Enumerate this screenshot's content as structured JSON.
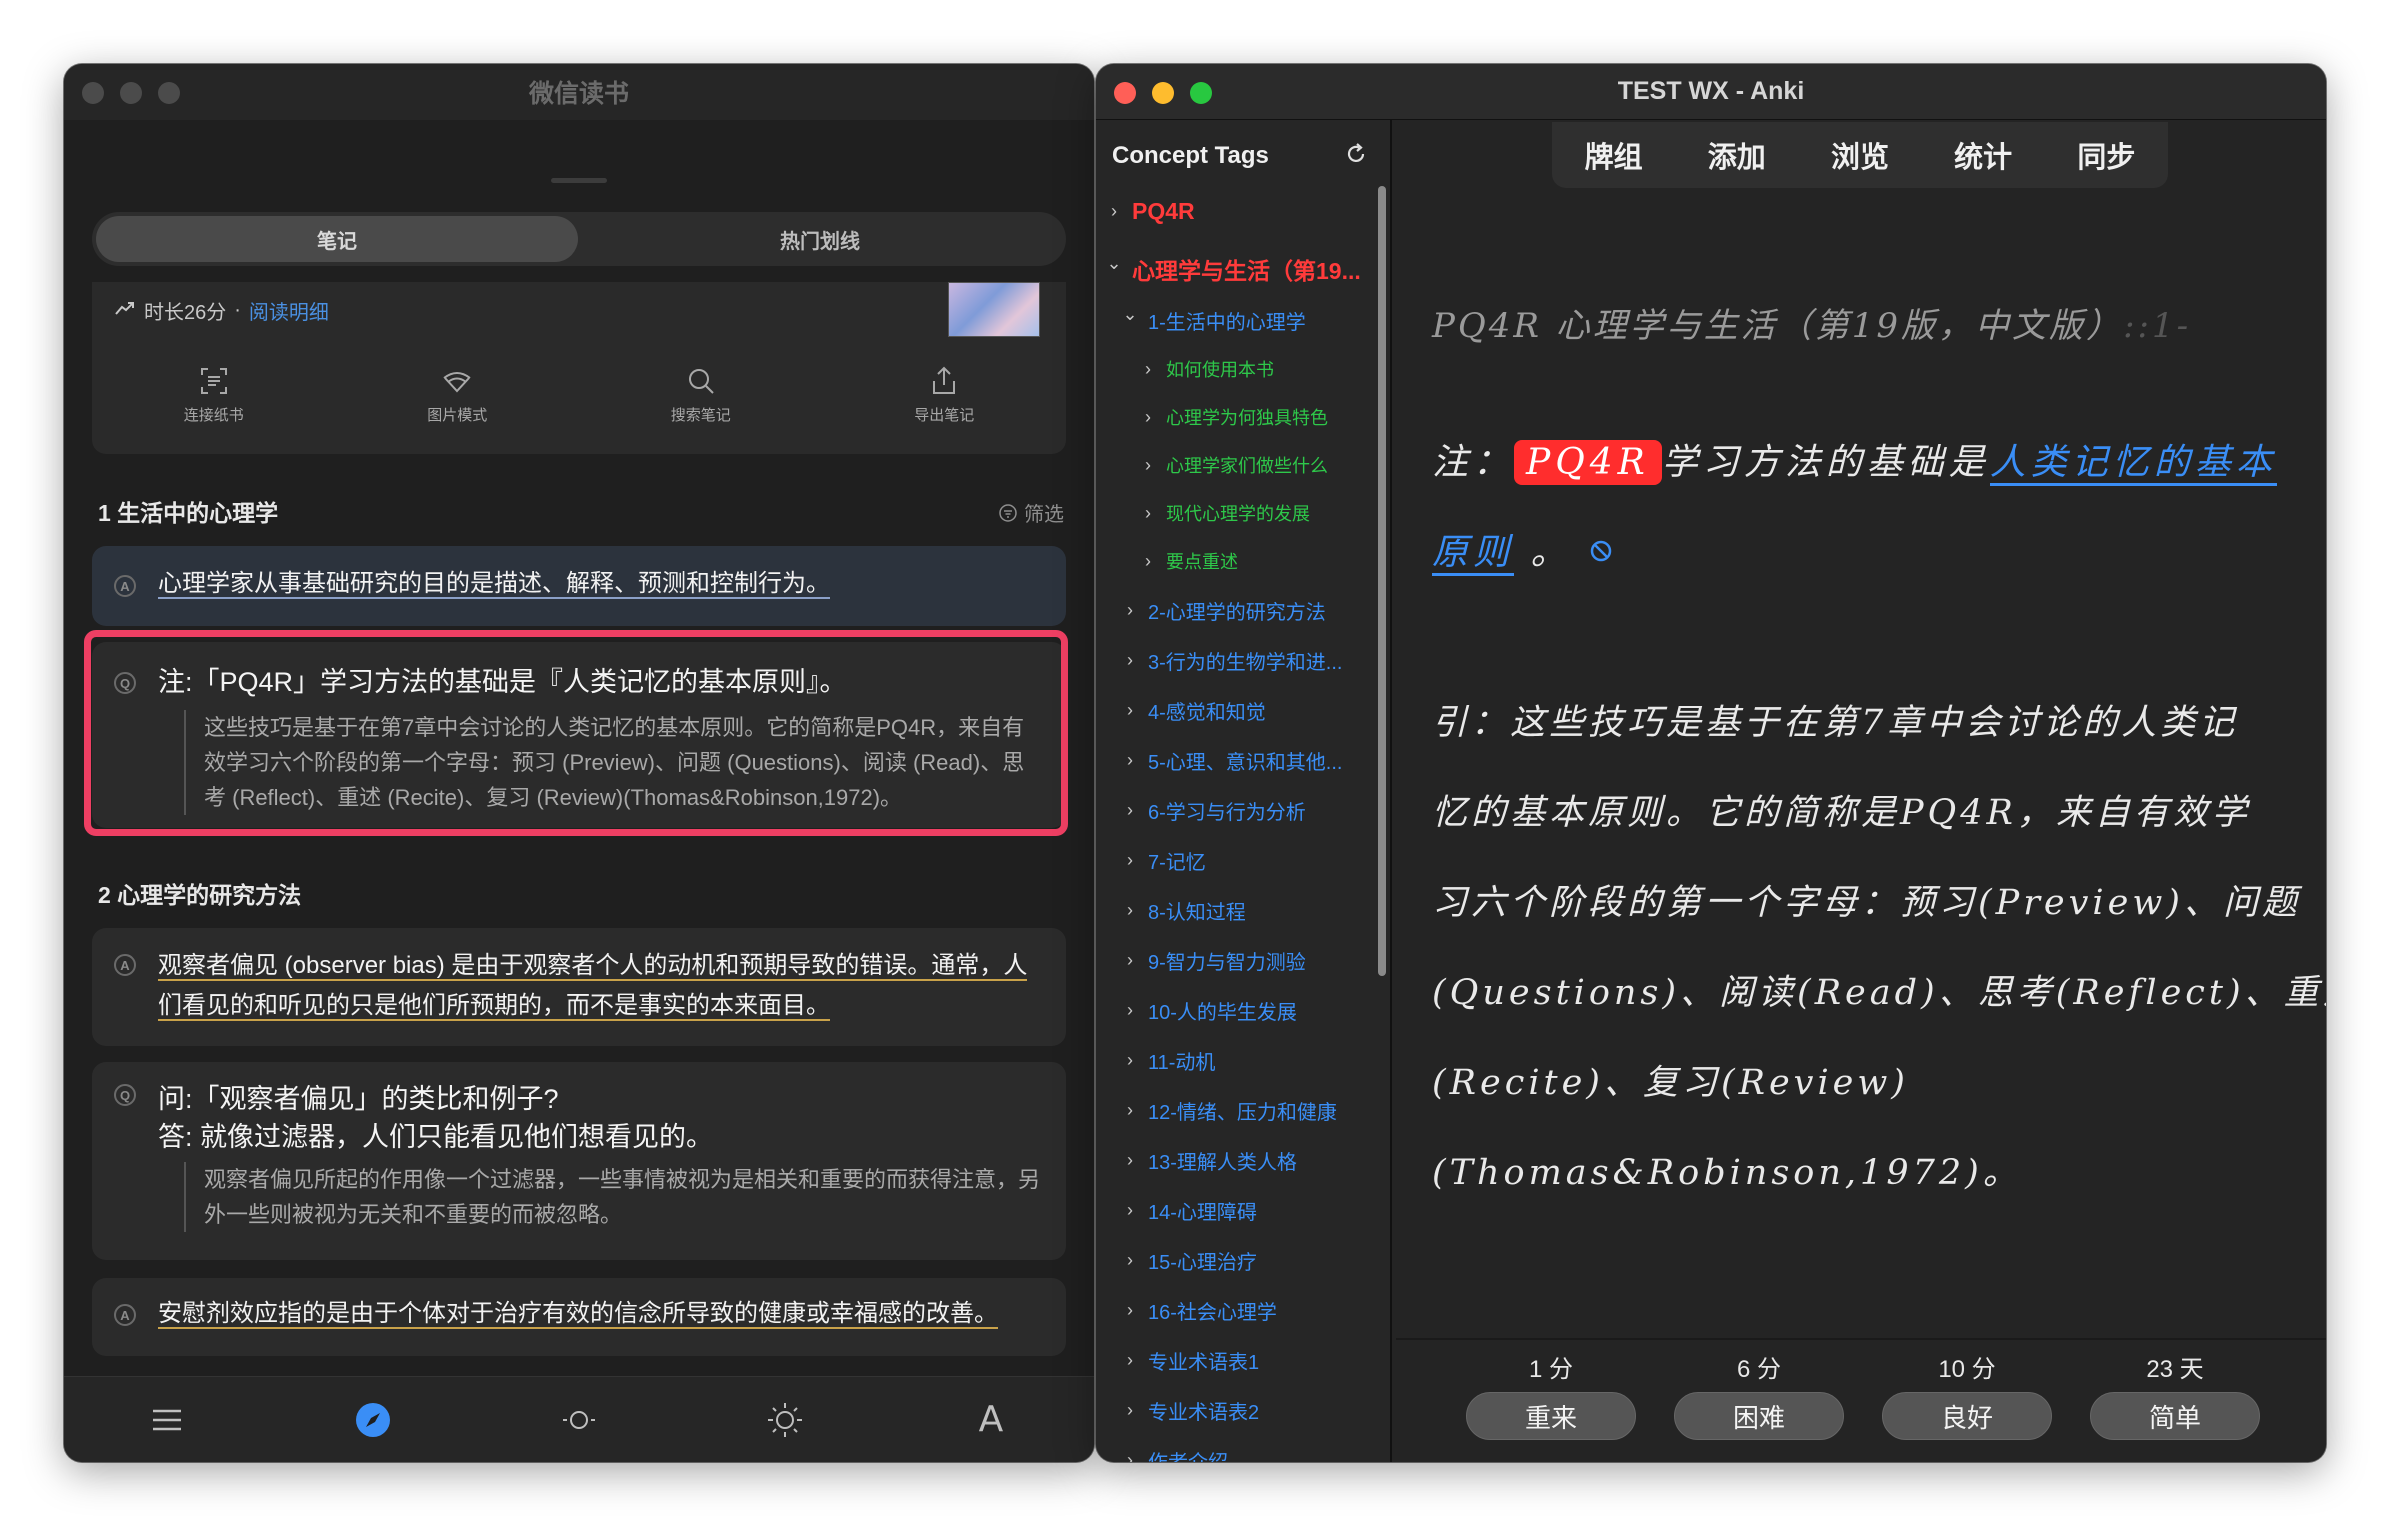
{
  "wechat": {
    "title": "微信读书",
    "tabs": {
      "notes": "笔记",
      "hot": "热门划线"
    },
    "reading": {
      "duration": "时长26分",
      "separator": "·",
      "detail_link": "阅读明细"
    },
    "tools": [
      {
        "label": "连接纸书",
        "icon": "scan-icon"
      },
      {
        "label": "图片模式",
        "icon": "image-mode-icon"
      },
      {
        "label": "搜索笔记",
        "icon": "search-icon"
      },
      {
        "label": "导出笔记",
        "icon": "export-icon"
      }
    ],
    "filter": "筛选",
    "section1": "1 生活中的心理学",
    "note1": "心理学家从事基础研究的目的是描述、解释、预测和控制行为。",
    "note2": {
      "title": "注:「PQ4R」学习方法的基础是『人类记忆的基本原则』。",
      "quote": "这些技巧是基于在第7章中会讨论的人类记忆的基本原则。它的简称是PQ4R，来自有效学习六个阶段的第一个字母：预习 (Preview)、问题 (Questions)、阅读 (Read)、思考 (Reflect)、重述 (Recite)、复习 (Review)(Thomas&Robinson,1972)。"
    },
    "section2": "2 心理学的研究方法",
    "note3": "观察者偏见 (observer bias) 是由于观察者个人的动机和预期导致的错误。通常，人们看见的和听见的只是他们所预期的，而不是事实的本来面目。",
    "note4": {
      "q": "问:「观察者偏见」的类比和例子?",
      "a": "答:  就像过滤器，人们只能看见他们想看见的。",
      "quote": "观察者偏见所起的作用像一个过滤器，一些事情被视为是相关和重要的而获得注意，另外一些则被视为无关和不重要的而被忽略。"
    },
    "note5": "安慰剂效应指的是由于个体对于治疗有效的信念所导致的健康或幸福感的改善。",
    "badges": {
      "a": "A",
      "q": "Q"
    },
    "bottom_icons": [
      "menu-icon",
      "compass-icon",
      "brightness-low-icon",
      "brightness-high-icon",
      "font-icon"
    ],
    "font_glyph": "A"
  },
  "anki": {
    "title": "TEST WX - Anki",
    "sidebar_title": "Concept Tags",
    "tree": [
      {
        "label": "PQ4R",
        "level": 0,
        "open": false,
        "color": "#ff3b3b"
      },
      {
        "label": "心理学与生活（第19...",
        "level": 0,
        "open": true,
        "color": "#ff3b3b"
      },
      {
        "label": "1-生活中的心理学",
        "level": 1,
        "open": true,
        "color": "#3a8ef6"
      },
      {
        "label": "如何使用本书",
        "level": 2,
        "open": false,
        "color": "#2ec84a"
      },
      {
        "label": "心理学为何独具特色",
        "level": 2,
        "open": false,
        "color": "#2ec84a"
      },
      {
        "label": "心理学家们做些什么",
        "level": 2,
        "open": false,
        "color": "#2ec84a"
      },
      {
        "label": "现代心理学的发展",
        "level": 2,
        "open": false,
        "color": "#2ec84a"
      },
      {
        "label": "要点重述",
        "level": 2,
        "open": false,
        "color": "#2ec84a"
      },
      {
        "label": "2-心理学的研究方法",
        "level": 1,
        "open": false,
        "color": "#3a8ef6"
      },
      {
        "label": "3-行为的生物学和进...",
        "level": 1,
        "open": false,
        "color": "#3a8ef6"
      },
      {
        "label": "4-感觉和知觉",
        "level": 1,
        "open": false,
        "color": "#3a8ef6"
      },
      {
        "label": "5-心理、意识和其他...",
        "level": 1,
        "open": false,
        "color": "#3a8ef6"
      },
      {
        "label": "6-学习与行为分析",
        "level": 1,
        "open": false,
        "color": "#3a8ef6"
      },
      {
        "label": "7-记忆",
        "level": 1,
        "open": false,
        "color": "#3a8ef6"
      },
      {
        "label": "8-认知过程",
        "level": 1,
        "open": false,
        "color": "#3a8ef6"
      },
      {
        "label": "9-智力与智力测验",
        "level": 1,
        "open": false,
        "color": "#3a8ef6"
      },
      {
        "label": "10-人的毕生发展",
        "level": 1,
        "open": false,
        "color": "#3a8ef6"
      },
      {
        "label": "11-动机",
        "level": 1,
        "open": false,
        "color": "#3a8ef6"
      },
      {
        "label": "12-情绪、压力和健康",
        "level": 1,
        "open": false,
        "color": "#3a8ef6"
      },
      {
        "label": "13-理解人类人格",
        "level": 1,
        "open": false,
        "color": "#3a8ef6"
      },
      {
        "label": "14-心理障碍",
        "level": 1,
        "open": false,
        "color": "#3a8ef6"
      },
      {
        "label": "15-心理治疗",
        "level": 1,
        "open": false,
        "color": "#3a8ef6"
      },
      {
        "label": "16-社会心理学",
        "level": 1,
        "open": false,
        "color": "#3a8ef6"
      },
      {
        "label": "专业术语表1",
        "level": 1,
        "open": false,
        "color": "#3a8ef6"
      },
      {
        "label": "专业术语表2",
        "level": 1,
        "open": false,
        "color": "#3a8ef6"
      },
      {
        "label": "作者介绍",
        "level": 1,
        "open": false,
        "color": "#3a8ef6"
      }
    ],
    "nav": [
      "牌组",
      "添加",
      "浏览",
      "统计",
      "同步"
    ],
    "card": {
      "header": "PQ4R 心理学与生活（第19版，中文版）",
      "header_fade": "::1-",
      "note_prefix": "注：",
      "tag": "PQ4R",
      "note_mid": "学习方法的基础是",
      "link_part1": "人类记忆的基本",
      "link_part2": "原则",
      "note_end": "。",
      "quote_lines": [
        "引：这些技巧是基于在第7章中会讨论的人类记",
        "忆的基本原则。它的简称是PQ4R，来自有效学",
        "习六个阶段的第一个字母：预习(Preview)、问题",
        "(Questions)、阅读(Read)、思考(Reflect)、重述",
        "(Recite)、复习(Review)",
        "(Thomas&Robinson,1972)。"
      ]
    },
    "answers": [
      {
        "time": "1 分",
        "label": "重来"
      },
      {
        "time": "6 分",
        "label": "困难"
      },
      {
        "time": "10 分",
        "label": "良好"
      },
      {
        "time": "23 天",
        "label": "简单"
      }
    ],
    "colors": {
      "tag_bg": "#ff2d2d",
      "link": "#3a8ef6",
      "highlight_border": "#ee3f63"
    }
  }
}
